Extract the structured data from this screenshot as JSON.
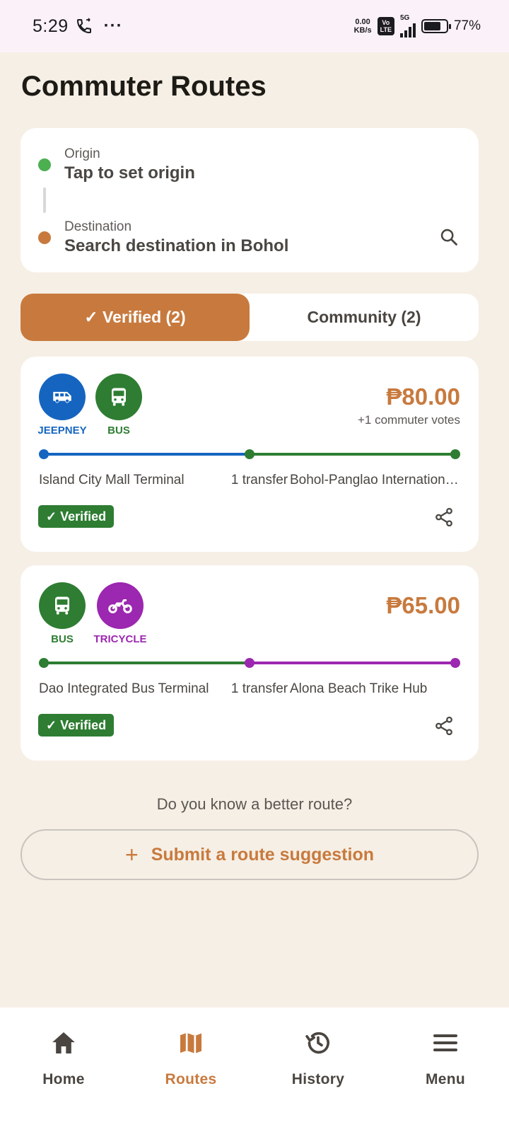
{
  "status": {
    "time": "5:29",
    "dots": "···",
    "net_speed_value": "0.00",
    "net_speed_unit": "KB/s",
    "volte_top": "Vo",
    "volte_bottom": "LTE",
    "network": "5G",
    "battery": "77%",
    "battery_level": 0.77
  },
  "header": {
    "title": "Commuter Routes"
  },
  "search": {
    "origin_label": "Origin",
    "origin_value": "Tap to set origin",
    "destination_label": "Destination",
    "destination_value": "Search destination in Bohol"
  },
  "tabs": {
    "verified": "✓ Verified (2)",
    "community": "Community (2)"
  },
  "routes": [
    {
      "modes": [
        {
          "label": "JEEPNEY",
          "icon": "van-icon",
          "color": "#1565c0"
        },
        {
          "label": "BUS",
          "icon": "bus-icon",
          "color": "#2e7d32"
        }
      ],
      "price": "₱80.00",
      "votes": "+1 commuter votes",
      "from": "Island City Mall Terminal",
      "transfer": "1 transfer",
      "to": "Bohol-Panglao International Airport",
      "badge": "✓ Verified"
    },
    {
      "modes": [
        {
          "label": "BUS",
          "icon": "bus-icon",
          "color": "#2e7d32"
        },
        {
          "label": "TRICYCLE",
          "icon": "motorcycle-icon",
          "color": "#9c27b0"
        }
      ],
      "price": "₱65.00",
      "from": "Dao Integrated Bus Terminal",
      "transfer": "1 transfer",
      "to": "Alona Beach Trike Hub",
      "badge": "✓ Verified"
    }
  ],
  "suggest": {
    "prompt": "Do you know a better route?",
    "plus": "+",
    "button": "Submit a route suggestion"
  },
  "nav": {
    "items": [
      {
        "label": "Home",
        "icon": "home-icon"
      },
      {
        "label": "Routes",
        "icon": "map-icon"
      },
      {
        "label": "History",
        "icon": "history-icon"
      },
      {
        "label": "Menu",
        "icon": "menu-icon"
      }
    ],
    "active": "Routes"
  },
  "colors": {
    "accent": "#c87a3e",
    "jeepney": "#1565c0",
    "bus": "#2e7d32",
    "tricycle": "#9c27b0",
    "origin_dot": "#4caf50"
  }
}
